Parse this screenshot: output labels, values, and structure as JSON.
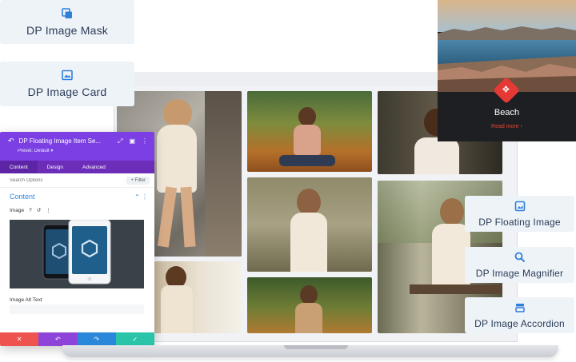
{
  "modules": {
    "image_mask": {
      "label": "DP Image Mask",
      "icon": "image-mask-icon"
    },
    "image_card": {
      "label": "DP Image Card",
      "icon": "image-card-icon"
    },
    "floating_image": {
      "label": "DP Floating Image",
      "icon": "floating-image-icon"
    },
    "image_magnifier": {
      "label": "DP Image Magnifier",
      "icon": "magnifier-icon"
    },
    "image_accordion": {
      "label": "DP Image Accordion",
      "icon": "accordion-icon"
    }
  },
  "beach_card": {
    "title": "Beach",
    "link": "Read more  ›",
    "badge_icon": "move-arrows-icon",
    "badge_glyph": "✥"
  },
  "panel": {
    "back_glyph": "↶",
    "title": "DP Floating Image Item Se...",
    "header_icons": [
      "⤢",
      "▣",
      "⋮"
    ],
    "preset": "Preset: Default ▾",
    "tabs": [
      {
        "label": "Content",
        "active": true
      },
      {
        "label": "Design",
        "active": false
      },
      {
        "label": "Advanced",
        "active": false
      }
    ],
    "search_placeholder": "Search Options",
    "filter_label": "+ Filter",
    "section_title": "Content",
    "section_toggle": "⌃  ⋮",
    "image_label": "Image",
    "image_field_icons": [
      "?",
      "↺",
      "⋮"
    ],
    "alt_label": "Image Alt Text",
    "footer": [
      {
        "name": "discard-button",
        "glyph": "✕",
        "color": "#ef5350"
      },
      {
        "name": "undo-button",
        "glyph": "↶",
        "color": "#8e44d9"
      },
      {
        "name": "redo-button",
        "glyph": "↷",
        "color": "#2b87da"
      },
      {
        "name": "save-button",
        "glyph": "✓",
        "color": "#29c4a9"
      }
    ]
  },
  "colors": {
    "accent_purple": "#7b3fe4",
    "accent_red": "#e53935",
    "card_bg": "#eef3f8",
    "label_navy": "#2a3b57"
  }
}
